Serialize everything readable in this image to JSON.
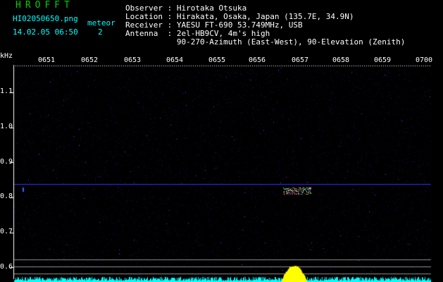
{
  "header": {
    "brand": "HROFFT",
    "filename": "HI02050650.png",
    "datetime": "14.02.05 06:50",
    "meteor_label": "meteor",
    "meteor_count": "2",
    "observer_line": "Observer : Hirotaka Otsuka",
    "location_line": "Location : Hirakata, Osaka, Japan (135.7E, 34.9N)",
    "receiver_line": "Receiver : YAESU FT-690 53.749MHz, USB",
    "antenna_line": "Antenna  : 2el-HB9CV, 4m's high",
    "antenna_line2": "           90-270-Azimuth (East-West), 90-Elevation (Zenith)"
  },
  "axis": {
    "y_unit": "kHz",
    "x_ticks": [
      "0651",
      "0652",
      "0653",
      "0654",
      "0655",
      "0656",
      "0657",
      "0658",
      "0659",
      "0700"
    ],
    "y_ticks": [
      "1.1",
      "1.0",
      "0.9",
      "0.8",
      "0.7",
      "0.6"
    ]
  },
  "colors": {
    "background": "#000000",
    "text": "#ffffff",
    "header_cyan": "#00ffff",
    "brand_green": "#00d000",
    "signal_line": "#3030ff",
    "meteor": "#ff4040",
    "peak": "#ffff00"
  }
}
